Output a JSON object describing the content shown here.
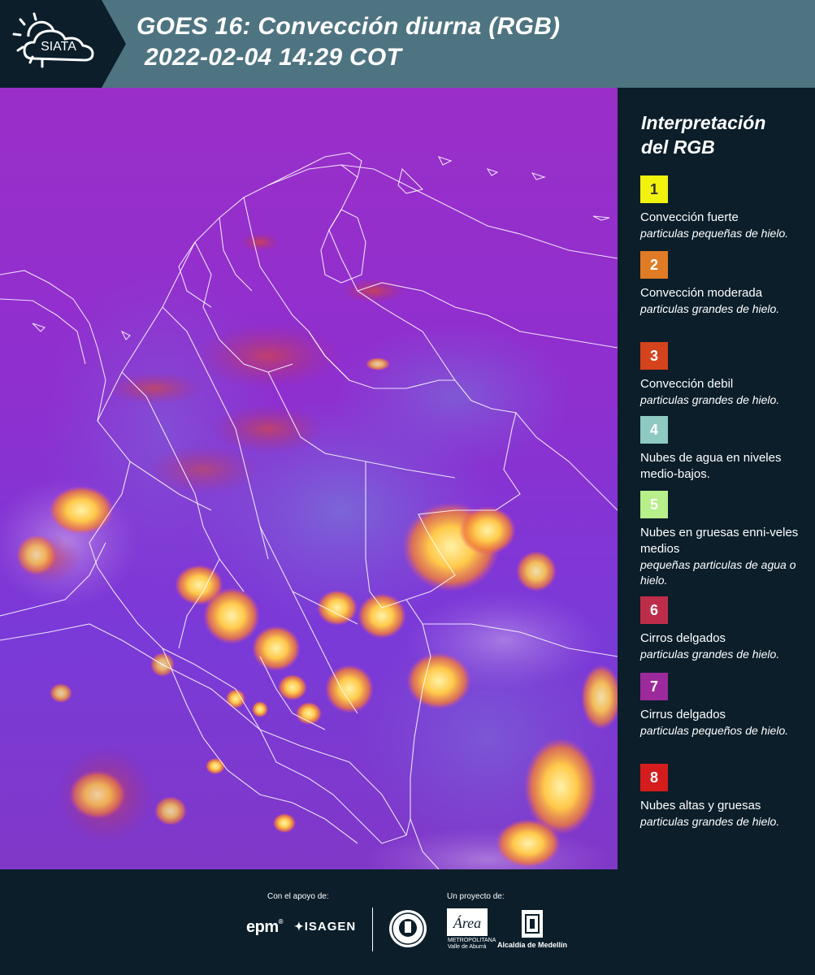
{
  "header": {
    "logo_text": "SIATA",
    "title_line1": "GOES 16: Convección diurna (RGB)",
    "title_line2": "2022-02-04 14:29 COT"
  },
  "legend": {
    "title_line1": "Interpretación",
    "title_line2": "del RGB",
    "items": [
      {
        "number": "1",
        "color": "#f2f20f",
        "title": "Convección fuerte",
        "desc": "particulas pequeñas de hielo."
      },
      {
        "number": "2",
        "color": "#e07b25",
        "title": "Convección moderada",
        "desc": "particulas grandes de hielo."
      },
      {
        "number": "3",
        "color": "#d4431c",
        "title": "Convección debil",
        "desc": "particulas grandes de hielo."
      },
      {
        "number": "4",
        "color": "#8ec9c2",
        "title": "Nubes de agua en niveles medio-bajos.",
        "desc": ""
      },
      {
        "number": "5",
        "color": "#b7ef8a",
        "title": "Nubes en gruesas enni-veles medios",
        "desc": "pequeñas particulas de agua o hielo."
      },
      {
        "number": "6",
        "color": "#bd2d4a",
        "title": "Cirros delgados",
        "desc": "particulas grandes de hielo."
      },
      {
        "number": "7",
        "color": "#9c2a9c",
        "title": "Cirrus delgados",
        "desc": "particulas pequeños de hielo."
      },
      {
        "number": "8",
        "color": "#d51d1d",
        "title": "Nubes altas y gruesas",
        "desc": "particulas grandes de hielo."
      }
    ]
  },
  "footer": {
    "support_label": "Con el apoyo de:",
    "project_label": "Un proyecto de:",
    "epm": "epm",
    "isagen": "ISAGEN",
    "area_line1": "Área",
    "area_line2": "METROPOLITANA",
    "area_line3": "Valle de Aburrá",
    "medellin": "Alcaldía de Medellín"
  },
  "colors": {
    "header_bg": "#4e7481",
    "logo_bg": "#0b1e2a",
    "map_bg": "#8b2ccf",
    "panel_bg": "#0b1e2a"
  }
}
